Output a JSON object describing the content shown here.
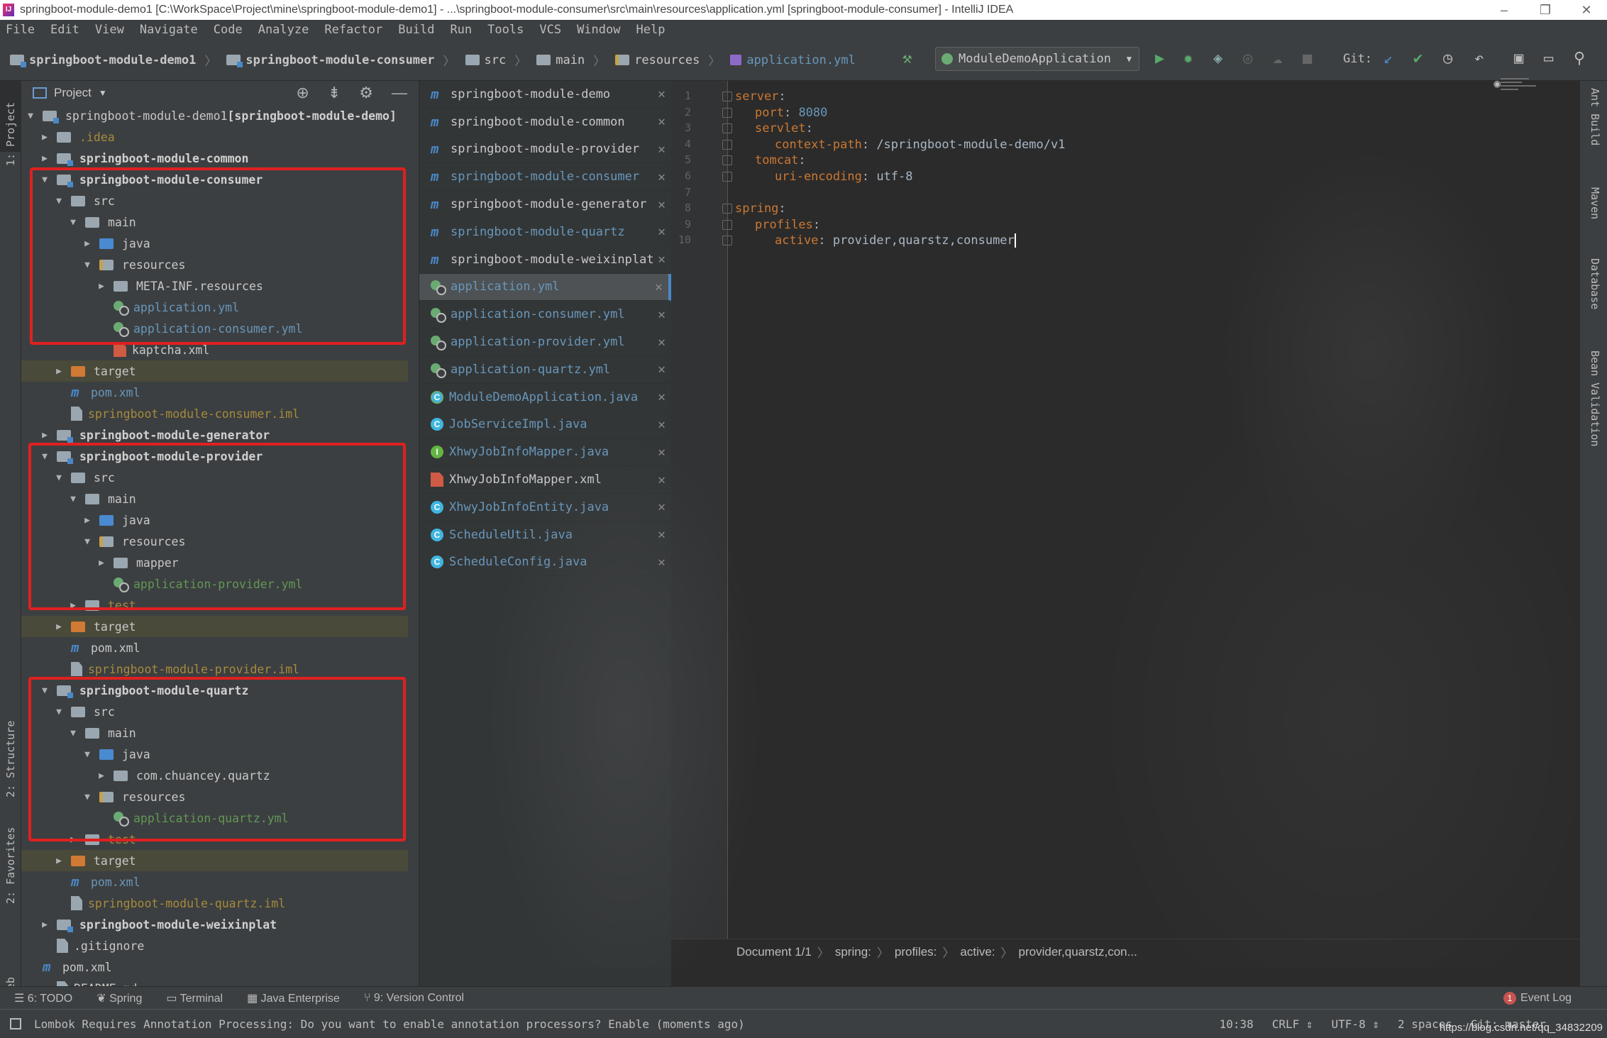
{
  "window": {
    "title": "springboot-module-demo1 [C:\\WorkSpace\\Project\\mine\\springboot-module-demo1] - ...\\springboot-module-consumer\\src\\main\\resources\\application.yml [springboot-module-consumer] - IntelliJ IDEA",
    "icon": "IJ"
  },
  "menu": [
    "File",
    "Edit",
    "View",
    "Navigate",
    "Code",
    "Analyze",
    "Refactor",
    "Build",
    "Run",
    "Tools",
    "VCS",
    "Window",
    "Help"
  ],
  "breadcrumbs": [
    "springboot-module-demo1",
    "springboot-module-consumer",
    "src",
    "main",
    "resources",
    "application.yml"
  ],
  "run_config": "ModuleDemoApplication",
  "git_label": "Git:",
  "project_panel": {
    "title": "Project"
  },
  "tree": [
    {
      "depth": 0,
      "arrow": "▼",
      "icon": "module-folder",
      "label": "springboot-module-demo1",
      "suffix": " [springboot-module-demo]",
      "style": "norm"
    },
    {
      "depth": 1,
      "arrow": "▶",
      "icon": "folder",
      "label": ".idea",
      "style": "olive"
    },
    {
      "depth": 1,
      "arrow": "▶",
      "icon": "module-folder",
      "label": "springboot-module-common",
      "style": "bold"
    },
    {
      "depth": 1,
      "arrow": "▼",
      "icon": "module-folder",
      "label": "springboot-module-consumer",
      "style": "bold"
    },
    {
      "depth": 2,
      "arrow": "▼",
      "icon": "folder",
      "label": "src",
      "style": "norm"
    },
    {
      "depth": 3,
      "arrow": "▼",
      "icon": "folder",
      "label": "main",
      "style": "norm"
    },
    {
      "depth": 4,
      "arrow": "▶",
      "icon": "folder-blue",
      "label": "java",
      "style": "norm"
    },
    {
      "depth": 4,
      "arrow": "▼",
      "icon": "folder-res",
      "label": "resources",
      "style": "norm"
    },
    {
      "depth": 5,
      "arrow": "▶",
      "icon": "folder",
      "label": "META-INF.resources",
      "style": "norm"
    },
    {
      "depth": 5,
      "arrow": "",
      "icon": "yml",
      "label": "application.yml",
      "style": "yml"
    },
    {
      "depth": 5,
      "arrow": "",
      "icon": "yml",
      "label": "application-consumer.yml",
      "style": "yml"
    },
    {
      "depth": 5,
      "arrow": "",
      "icon": "xml",
      "label": "kaptcha.xml",
      "style": "norm"
    },
    {
      "depth": 2,
      "arrow": "▶",
      "icon": "folder-orange",
      "label": "target",
      "style": "norm",
      "hl": true
    },
    {
      "depth": 2,
      "arrow": "",
      "icon": "maven",
      "label": "pom.xml",
      "style": "yml"
    },
    {
      "depth": 2,
      "arrow": "",
      "icon": "file",
      "label": "springboot-module-consumer.iml",
      "style": "olive"
    },
    {
      "depth": 1,
      "arrow": "▶",
      "icon": "module-folder",
      "label": "springboot-module-generator",
      "style": "bold"
    },
    {
      "depth": 1,
      "arrow": "▼",
      "icon": "module-folder",
      "label": "springboot-module-provider",
      "style": "bold"
    },
    {
      "depth": 2,
      "arrow": "▼",
      "icon": "folder",
      "label": "src",
      "style": "norm"
    },
    {
      "depth": 3,
      "arrow": "▼",
      "icon": "folder",
      "label": "main",
      "style": "norm"
    },
    {
      "depth": 4,
      "arrow": "▶",
      "icon": "folder-blue",
      "label": "java",
      "style": "norm"
    },
    {
      "depth": 4,
      "arrow": "▼",
      "icon": "folder-res",
      "label": "resources",
      "style": "norm"
    },
    {
      "depth": 5,
      "arrow": "▶",
      "icon": "folder",
      "label": "mapper",
      "style": "norm"
    },
    {
      "depth": 5,
      "arrow": "",
      "icon": "yml",
      "label": "application-provider.yml",
      "style": "green"
    },
    {
      "depth": 3,
      "arrow": "▶",
      "icon": "folder",
      "label": "test",
      "style": "olive"
    },
    {
      "depth": 2,
      "arrow": "▶",
      "icon": "folder-orange",
      "label": "target",
      "style": "norm",
      "hl": true
    },
    {
      "depth": 2,
      "arrow": "",
      "icon": "maven",
      "label": "pom.xml",
      "style": "norm"
    },
    {
      "depth": 2,
      "arrow": "",
      "icon": "file",
      "label": "springboot-module-provider.iml",
      "style": "olive"
    },
    {
      "depth": 1,
      "arrow": "▼",
      "icon": "module-folder",
      "label": "springboot-module-quartz",
      "style": "bold"
    },
    {
      "depth": 2,
      "arrow": "▼",
      "icon": "folder",
      "label": "src",
      "style": "norm"
    },
    {
      "depth": 3,
      "arrow": "▼",
      "icon": "folder",
      "label": "main",
      "style": "norm"
    },
    {
      "depth": 4,
      "arrow": "▼",
      "icon": "folder-blue",
      "label": "java",
      "style": "norm"
    },
    {
      "depth": 5,
      "arrow": "▶",
      "icon": "folder",
      "label": "com.chuancey.quartz",
      "style": "norm"
    },
    {
      "depth": 4,
      "arrow": "▼",
      "icon": "folder-res",
      "label": "resources",
      "style": "norm"
    },
    {
      "depth": 5,
      "arrow": "",
      "icon": "yml",
      "label": "application-quartz.yml",
      "style": "green"
    },
    {
      "depth": 3,
      "arrow": "▶",
      "icon": "folder",
      "label": "test",
      "style": "olive"
    },
    {
      "depth": 2,
      "arrow": "▶",
      "icon": "folder-orange",
      "label": "target",
      "style": "norm",
      "hl": true
    },
    {
      "depth": 2,
      "arrow": "",
      "icon": "maven",
      "label": "pom.xml",
      "style": "yml"
    },
    {
      "depth": 2,
      "arrow": "",
      "icon": "file",
      "label": "springboot-module-quartz.iml",
      "style": "olive"
    },
    {
      "depth": 1,
      "arrow": "▶",
      "icon": "module-folder",
      "label": "springboot-module-weixinplat",
      "style": "bold"
    },
    {
      "depth": 1,
      "arrow": "",
      "icon": "file",
      "label": ".gitignore",
      "style": "norm"
    },
    {
      "depth": 0,
      "arrow": "",
      "icon": "maven",
      "label": "pom.xml",
      "style": "norm"
    },
    {
      "depth": 1,
      "arrow": "",
      "icon": "file",
      "label": "README.md",
      "style": "norm"
    }
  ],
  "tabs": [
    {
      "icon": "maven",
      "label": "springboot-module-demo",
      "color": "#c8c8c8"
    },
    {
      "icon": "maven",
      "label": "springboot-module-common",
      "color": "#c8c8c8"
    },
    {
      "icon": "maven",
      "label": "springboot-module-provider",
      "color": "#c8c8c8"
    },
    {
      "icon": "maven",
      "label": "springboot-module-consumer",
      "color": "#6897bb"
    },
    {
      "icon": "maven",
      "label": "springboot-module-generator",
      "color": "#c8c8c8"
    },
    {
      "icon": "maven",
      "label": "springboot-module-quartz",
      "color": "#6897bb"
    },
    {
      "icon": "maven",
      "label": "springboot-module-weixinplat",
      "color": "#c8c8c8"
    },
    {
      "icon": "yml",
      "label": "application.yml",
      "color": "#6897bb",
      "active": true
    },
    {
      "icon": "yml",
      "label": "application-consumer.yml",
      "color": "#6897bb"
    },
    {
      "icon": "yml",
      "label": "application-provider.yml",
      "color": "#6897bb"
    },
    {
      "icon": "yml",
      "label": "application-quartz.yml",
      "color": "#6897bb"
    },
    {
      "icon": "spring-class",
      "label": "ModuleDemoApplication.java",
      "color": "#6897bb"
    },
    {
      "icon": "class",
      "label": "JobServiceImpl.java",
      "color": "#6897bb"
    },
    {
      "icon": "interface",
      "label": "XhwyJobInfoMapper.java",
      "color": "#6897bb"
    },
    {
      "icon": "xml",
      "label": "XhwyJobInfoMapper.xml",
      "color": "#c8c8c8"
    },
    {
      "icon": "class",
      "label": "XhwyJobInfoEntity.java",
      "color": "#6897bb"
    },
    {
      "icon": "class",
      "label": "ScheduleUtil.java",
      "color": "#6897bb"
    },
    {
      "icon": "class",
      "label": "ScheduleConfig.java",
      "color": "#6897bb"
    }
  ],
  "editor": {
    "lines": [
      {
        "n": "1",
        "indent": 0,
        "key": "server",
        "sep": ":",
        "val": "",
        "valtype": ""
      },
      {
        "n": "2",
        "indent": 1,
        "key": "port",
        "sep": ": ",
        "val": "8080",
        "valtype": "num"
      },
      {
        "n": "3",
        "indent": 1,
        "key": "servlet",
        "sep": ":",
        "val": "",
        "valtype": ""
      },
      {
        "n": "4",
        "indent": 2,
        "key": "context-path",
        "sep": ": ",
        "val": "/springboot-module-demo/v1",
        "valtype": "str"
      },
      {
        "n": "5",
        "indent": 1,
        "key": "tomcat",
        "sep": ":",
        "val": "",
        "valtype": ""
      },
      {
        "n": "6",
        "indent": 2,
        "key": "uri-encoding",
        "sep": ": ",
        "val": "utf-8",
        "valtype": "str"
      },
      {
        "n": "7",
        "indent": 0,
        "key": "",
        "sep": "",
        "val": "",
        "valtype": ""
      },
      {
        "n": "8",
        "indent": 0,
        "key": "spring",
        "sep": ":",
        "val": "",
        "valtype": ""
      },
      {
        "n": "9",
        "indent": 1,
        "key": "profiles",
        "sep": ":",
        "val": "",
        "valtype": ""
      },
      {
        "n": "10",
        "indent": 2,
        "key": "active",
        "sep": ": ",
        "val": "provider,quarstz,consumer",
        "valtype": "str",
        "caret": true
      }
    ],
    "status_path": [
      "Document 1/1",
      "spring:",
      "profiles:",
      "active:",
      "provider,quarstz,con..."
    ]
  },
  "left_tool_windows": [
    "1: Project",
    "2: Structure",
    "2: Favorites",
    "Web"
  ],
  "right_tool_windows": [
    "Ant Build",
    "Maven",
    "Database",
    "Bean Validation"
  ],
  "bottom_tool_windows": [
    "6: TODO",
    "Spring",
    "Terminal",
    "Java Enterprise",
    "9: Version Control"
  ],
  "event_log": {
    "label": "Event Log",
    "count": "1"
  },
  "status": {
    "message": "Lombok Requires Annotation Processing: Do you want to enable annotation processors? Enable (moments ago)",
    "position": "10:38",
    "line_sep": "CRLF",
    "encoding": "UTF-8",
    "indent": "2 spaces",
    "vcs": "Git: master"
  },
  "watermark": "https://blog.csdn.net/qq_34832209",
  "colors": {
    "highlight_box": "#e02020",
    "accent": "#4a88c7"
  }
}
